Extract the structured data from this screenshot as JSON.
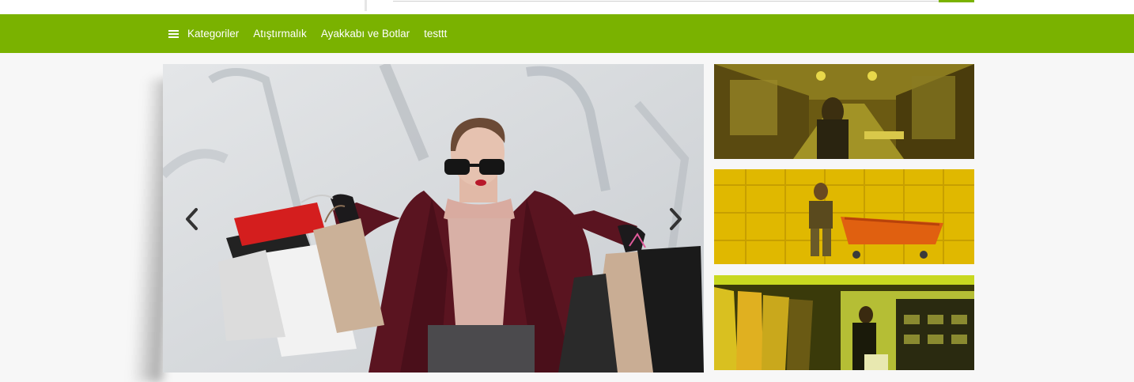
{
  "nav": {
    "categories_label": "Kategoriler",
    "items": [
      "Atıştırmalık",
      "Ayakkabı ve Botlar",
      "testtt"
    ]
  },
  "colors": {
    "brand_green": "#7ab200",
    "page_background": "#f7f7f7"
  },
  "icons": {
    "menu": "hamburger-menu-icon",
    "prev": "chevron-left-icon",
    "next": "chevron-right-icon"
  },
  "slider": {
    "image": "woman-with-shopping-bags",
    "prev_icon": "chevron-left-icon",
    "next_icon": "chevron-right-icon"
  },
  "side_banners": [
    {
      "image": "shopping-arcade-street"
    },
    {
      "image": "man-with-shopping-cart"
    },
    {
      "image": "clothing-store-interior"
    }
  ]
}
